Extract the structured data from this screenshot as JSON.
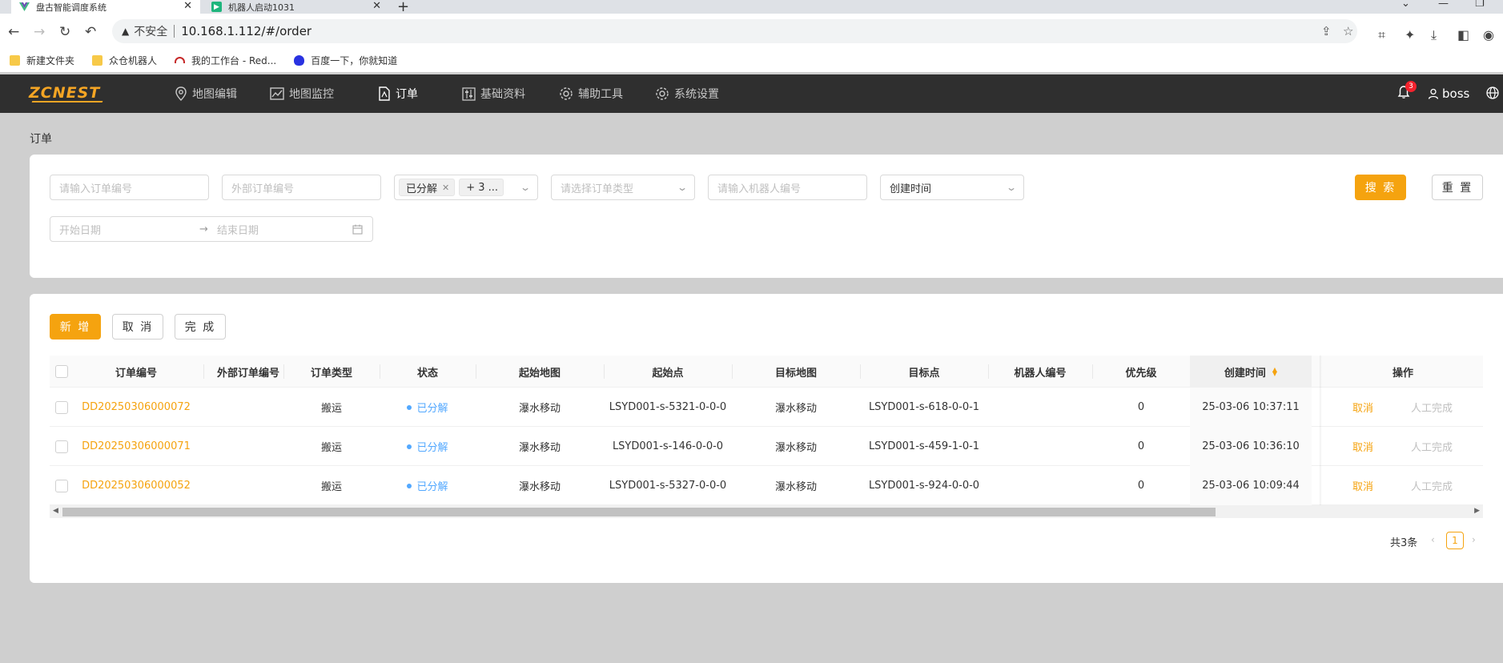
{
  "browser": {
    "tabs": [
      {
        "title": "盘古智能调度系统",
        "close": "✕"
      },
      {
        "title": "机器人启动1031",
        "close": "✕"
      }
    ],
    "new_tab": "+",
    "insecure_label": "不安全",
    "url": "10.168.1.112/#/order",
    "bookmarks": [
      {
        "label": "新建文件夹",
        "icon": "folder-icon"
      },
      {
        "label": "众仓机器人",
        "icon": "folder-icon"
      },
      {
        "label": "我的工作台 - Red...",
        "icon": "redmine-icon"
      },
      {
        "label": "百度一下，你就知道",
        "icon": "baidu-icon"
      }
    ]
  },
  "app": {
    "logo": "ZCNEST",
    "menu": [
      {
        "label": "地图编辑",
        "icon": "map-pin-icon"
      },
      {
        "label": "地图监控",
        "icon": "line-chart-icon"
      },
      {
        "label": "订单",
        "icon": "file-icon",
        "active": true
      },
      {
        "label": "基础资料",
        "icon": "sliders-icon"
      },
      {
        "label": "辅助工具",
        "icon": "gear-icon"
      },
      {
        "label": "系统设置",
        "icon": "gear-icon"
      }
    ],
    "notification_count": "3",
    "username": "boss",
    "accent_color": "#f5a30f"
  },
  "page": {
    "breadcrumb": "订单"
  },
  "filters": {
    "order_no_placeholder": "请输入订单编号",
    "external_no_placeholder": "外部订单编号",
    "status_tag": "已分解",
    "status_more": "+ 3 ...",
    "order_type_placeholder": "请选择订单类型",
    "robot_placeholder": "请输入机器人编号",
    "time_field": "创建时间",
    "start_date_placeholder": "开始日期",
    "end_date_placeholder": "结束日期",
    "search_label": "搜 索",
    "reset_label": "重 置"
  },
  "actions": {
    "add_label": "新 增",
    "cancel_label": "取 消",
    "complete_label": "完 成"
  },
  "table": {
    "columns": [
      "订单编号",
      "外部订单编号",
      "订单类型",
      "状态",
      "起始地图",
      "起始点",
      "目标地图",
      "目标点",
      "机器人编号",
      "优先级",
      "创建时间",
      "操作"
    ],
    "rows": [
      {
        "order_no": "DD20250306000072",
        "external_no": "",
        "type": "搬运",
        "status": "已分解",
        "start_map": "瀑水移动",
        "start_point": "LSYD001-s-5321-0-0-0",
        "target_map": "瀑水移动",
        "target_point": "LSYD001-s-618-0-0-1",
        "robot": "",
        "priority": "0",
        "created": "25-03-06 10:37:11",
        "op_cancel": "取消",
        "op_done": "人工完成"
      },
      {
        "order_no": "DD20250306000071",
        "external_no": "",
        "type": "搬运",
        "status": "已分解",
        "start_map": "瀑水移动",
        "start_point": "LSYD001-s-146-0-0-0",
        "target_map": "瀑水移动",
        "target_point": "LSYD001-s-459-1-0-1",
        "robot": "",
        "priority": "0",
        "created": "25-03-06 10:36:10",
        "op_cancel": "取消",
        "op_done": "人工完成"
      },
      {
        "order_no": "DD20250306000052",
        "external_no": "",
        "type": "搬运",
        "status": "已分解",
        "start_map": "瀑水移动",
        "start_point": "LSYD001-s-5327-0-0-0",
        "target_map": "瀑水移动",
        "target_point": "LSYD001-s-924-0-0-0",
        "robot": "",
        "priority": "0",
        "created": "25-03-06 10:09:44",
        "op_cancel": "取消",
        "op_done": "人工完成"
      }
    ]
  },
  "pagination": {
    "total_label": "共3条",
    "current_page": "1"
  }
}
